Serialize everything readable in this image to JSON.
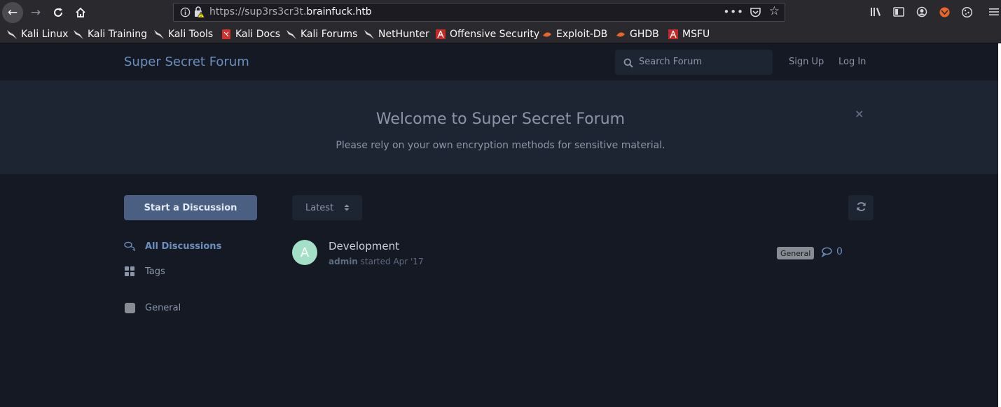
{
  "browser": {
    "url_prefix": "https://sup3rs3cr3t.",
    "url_host": "brainfuck.htb",
    "bookmarks": [
      {
        "label": "Kali Linux",
        "icon": "kali-dragon-icon"
      },
      {
        "label": "Kali Training",
        "icon": "kali-dragon-icon"
      },
      {
        "label": "Kali Tools",
        "icon": "kali-dragon-icon"
      },
      {
        "label": "Kali Docs",
        "icon": "kali-docs-icon"
      },
      {
        "label": "Kali Forums",
        "icon": "kali-dragon-icon"
      },
      {
        "label": "NetHunter",
        "icon": "kali-dragon-icon"
      },
      {
        "label": "Offensive Security",
        "icon": "offsec-icon"
      },
      {
        "label": "Exploit-DB",
        "icon": "exploitdb-icon"
      },
      {
        "label": "GHDB",
        "icon": "exploitdb-icon"
      },
      {
        "label": "MSFU",
        "icon": "offsec-icon"
      }
    ]
  },
  "header": {
    "brand": "Super Secret Forum",
    "search_placeholder": "Search Forum",
    "sign_up": "Sign Up",
    "log_in": "Log In"
  },
  "hero": {
    "title": "Welcome to Super Secret Forum",
    "subtitle": "Please rely on your own encryption methods for sensitive material.",
    "close": "×"
  },
  "sidebar": {
    "start_button": "Start a Discussion",
    "items": [
      {
        "label": "All Discussions",
        "icon": "comments-icon"
      },
      {
        "label": "Tags",
        "icon": "tags-grid-icon"
      },
      {
        "label": "General",
        "icon": "tag-swatch"
      }
    ]
  },
  "toolbar": {
    "sort_label": "Latest"
  },
  "discussions": [
    {
      "avatar_letter": "A",
      "title": "Development",
      "user": "admin",
      "meta": " started Apr '17",
      "tag": "General",
      "replies": "0"
    }
  ],
  "colors": {
    "background": "#141923",
    "hero": "#1e2532",
    "accent": "#6c8ebf",
    "button": "#4a5f82",
    "avatar": "#a4e0c7"
  }
}
